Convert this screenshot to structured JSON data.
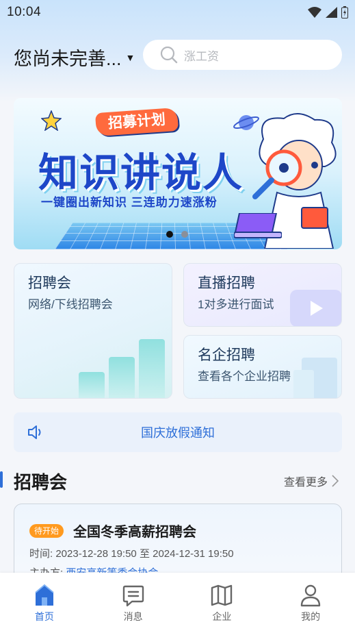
{
  "status_bar": {
    "time": "10:04"
  },
  "header": {
    "location": "您尚未完善...",
    "search_placeholder": "涨工资"
  },
  "banner": {
    "tag": "招募计划",
    "title": "知识讲说人",
    "subtitle": "一键圈出新知识  三连助力速涨粉",
    "page_count": 2,
    "active_page": 0
  },
  "cards": {
    "job_fair": {
      "title": "招聘会",
      "subtitle": "网络/下线招聘会"
    },
    "live": {
      "title": "直播招聘",
      "subtitle": "1对多进行面试"
    },
    "famous": {
      "title": "名企招聘",
      "subtitle": "查看各个企业招聘"
    }
  },
  "notice": {
    "text": "国庆放假通知"
  },
  "section": {
    "title": "招聘会",
    "more": "查看更多"
  },
  "fair": {
    "badge": "待开始",
    "title": "全国冬季高薪招聘会",
    "time_label": "时间:",
    "time_value": "2023-12-28 19:50 至 2024-12-31 19:50",
    "host_label": "主办方:",
    "host_value": "西安高新等委会协会"
  },
  "tabs": [
    {
      "label": "首页",
      "icon": "home-icon",
      "active": true
    },
    {
      "label": "消息",
      "icon": "message-icon",
      "active": false
    },
    {
      "label": "企业",
      "icon": "map-icon",
      "active": false
    },
    {
      "label": "我的",
      "icon": "user-icon",
      "active": false
    }
  ],
  "colors": {
    "accent": "#2e6fd8",
    "badge": "#ff9a1f"
  }
}
